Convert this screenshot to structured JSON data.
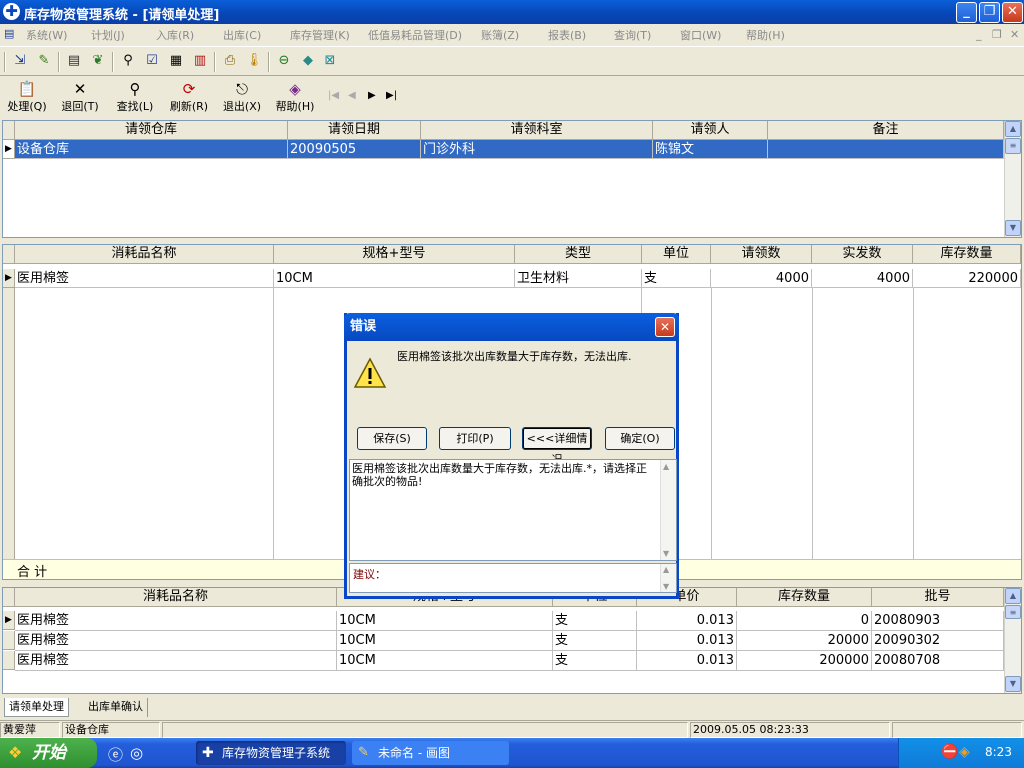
{
  "window": {
    "title": "库存物资管理系统 - [请领单处理]",
    "logo_icon": "app-cross-icon"
  },
  "menu": {
    "items": [
      "系统(W)",
      "计划(J)",
      "入库(R)",
      "出库(C)",
      "库存管理(K)",
      "低值易耗品管理(D)",
      "账簿(Z)",
      "报表(B)",
      "查询(T)",
      "窗口(W)",
      "帮助(H)"
    ]
  },
  "toolbar2": {
    "buttons": [
      {
        "label": "处理(Q)",
        "icon": "process-icon"
      },
      {
        "label": "退回(T)",
        "icon": "return-x-icon"
      },
      {
        "label": "查找(L)",
        "icon": "find-icon"
      },
      {
        "label": "刷新(R)",
        "icon": "refresh-icon"
      },
      {
        "label": "退出(X)",
        "icon": "exit-icon"
      },
      {
        "label": "帮助(H)",
        "icon": "help-book-icon"
      }
    ]
  },
  "request_grid": {
    "headers": [
      "请领仓库",
      "请领日期",
      "请领科室",
      "请领人",
      "备注"
    ],
    "rows": [
      [
        "设备仓库",
        "20090505",
        "门诊外科",
        "陈锦文",
        ""
      ]
    ]
  },
  "detail_grid": {
    "headers": [
      "消耗品名称",
      "规格+型号",
      "类型",
      "单位",
      "请领数",
      "实发数",
      "库存数量"
    ],
    "rows": [
      [
        "医用棉签",
        "10CM",
        "卫生材料",
        "支",
        "4000",
        "4000",
        "220000"
      ]
    ],
    "total_label": "合  计"
  },
  "stock_grid": {
    "headers": [
      "消耗品名称",
      "规格+型号",
      "单位",
      "单价",
      "库存数量",
      "批号"
    ],
    "rows": [
      [
        "医用棉签",
        "10CM",
        "支",
        "0.013",
        "0",
        "20080903"
      ],
      [
        "医用棉签",
        "10CM",
        "支",
        "0.013",
        "20000",
        "20090302"
      ],
      [
        "医用棉签",
        "10CM",
        "支",
        "0.013",
        "200000",
        "20080708"
      ]
    ]
  },
  "dialog": {
    "title": "错误",
    "message": "医用棉签该批次出库数量大于库存数，无法出库.",
    "buttons": {
      "save": "保存(S)",
      "print": "打印(P)",
      "details": "<<<详细情况",
      "ok": "确定(O)"
    },
    "detail_text": "医用棉签该批次出库数量大于库存数，无法出库.*，请选择正确批次的物品!",
    "suggestion_label": "建议："
  },
  "tabs": [
    "请领单处理",
    "出库单确认"
  ],
  "status": {
    "user": "黄爱萍",
    "warehouse": "设备仓库",
    "datetime": "2009.05.05 08:23:33"
  },
  "taskbar": {
    "start": "开始",
    "tasks": [
      "库存物资管理子系统",
      "未命名 - 画图"
    ],
    "clock": "8:23"
  },
  "colors": {
    "selection": "#316ac5",
    "title_bar": "#0a5fd8",
    "taskbar": "#245edb"
  }
}
